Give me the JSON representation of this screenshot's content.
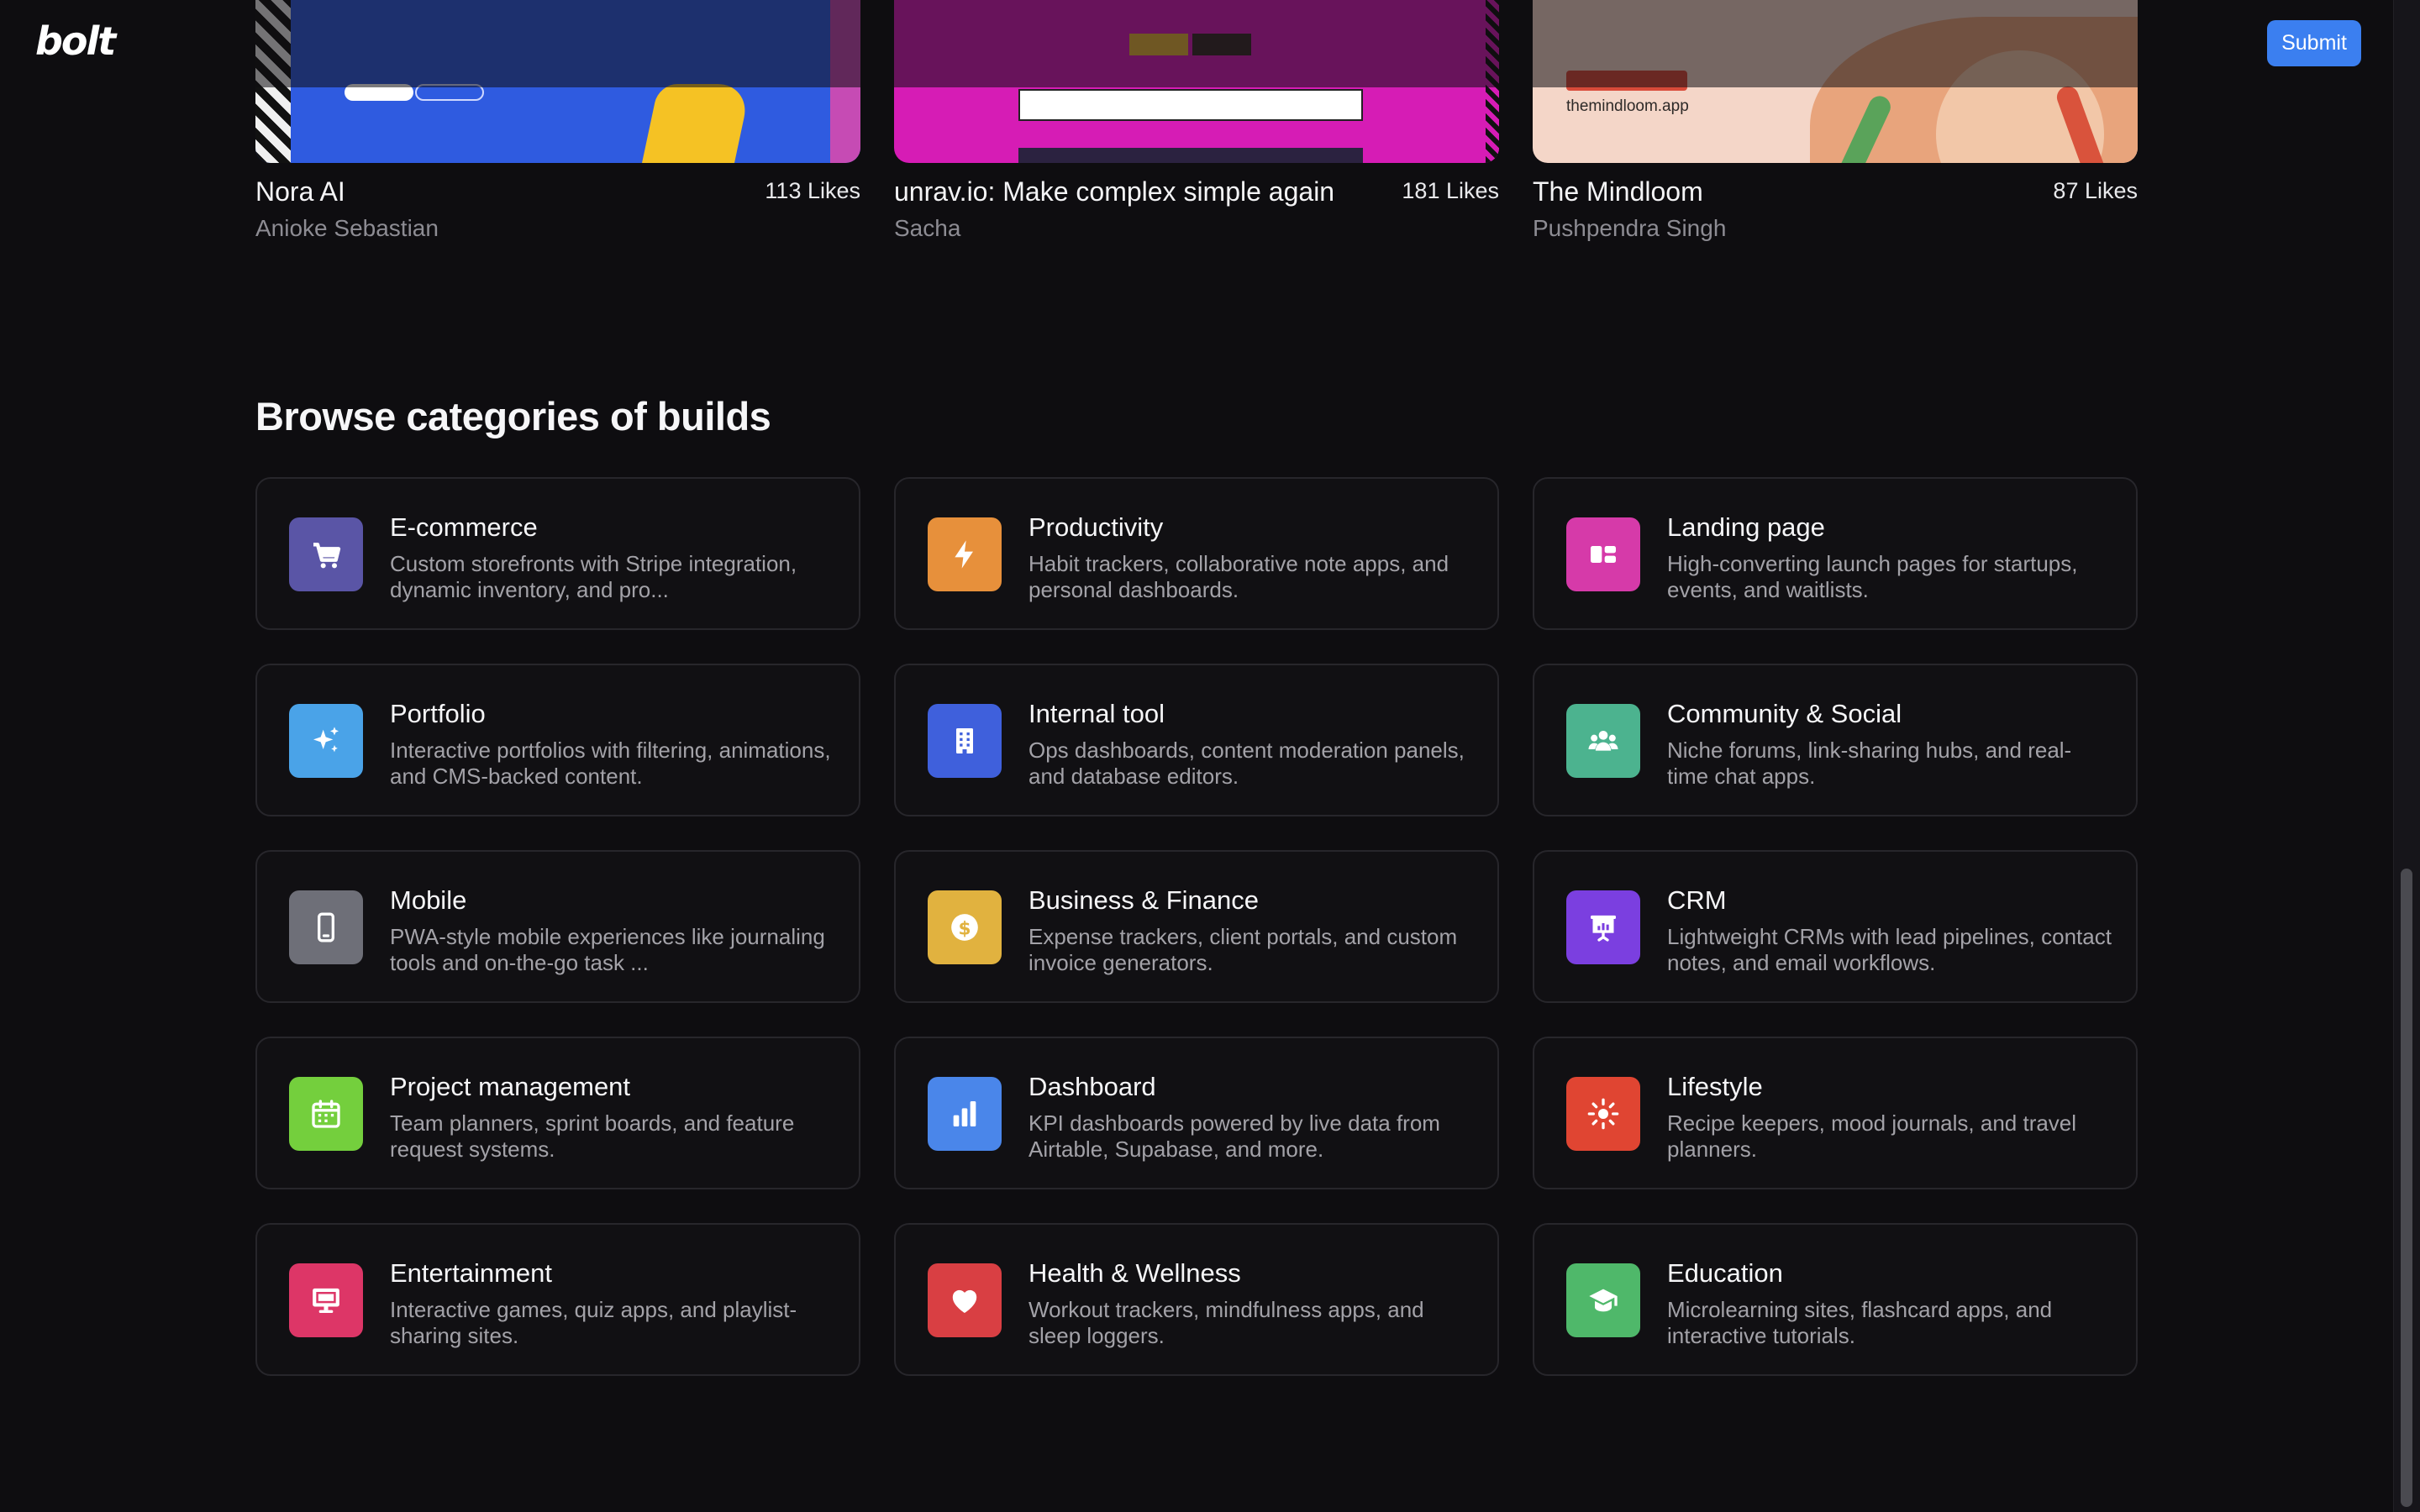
{
  "header": {
    "logo_text": "bolt",
    "submit_label": "Submit"
  },
  "showcase": [
    {
      "title": "Nora AI",
      "author": "Anioke Sebastian",
      "likes": "113 Likes"
    },
    {
      "title": "unrav.io: Make complex simple again",
      "author": "Sacha",
      "likes": "181 Likes"
    },
    {
      "title": "The Mindloom",
      "author": "Pushpendra Singh",
      "likes": "87 Likes",
      "thumb_domain": "themindloom.app"
    }
  ],
  "categories_section": {
    "title": "Browse categories of builds",
    "items": [
      {
        "name": "E-commerce",
        "description": "Custom storefronts with Stripe integration, dynamic inventory, and pro...",
        "icon": "cart-icon",
        "color": "#5a55a6"
      },
      {
        "name": "Productivity",
        "description": "Habit trackers, collaborative note apps, and personal dashboards.",
        "icon": "lightning-icon",
        "color": "#e7903b"
      },
      {
        "name": "Landing page",
        "description": "High-converting launch pages for startups, events, and waitlists.",
        "icon": "layout-icon",
        "color": "#d63aa9"
      },
      {
        "name": "Portfolio",
        "description": "Interactive portfolios with filtering, animations, and CMS-backed content.",
        "icon": "sparkles-icon",
        "color": "#4aa3e8"
      },
      {
        "name": "Internal tool",
        "description": "Ops dashboards, content moderation panels, and database editors.",
        "icon": "building-icon",
        "color": "#3f60dc"
      },
      {
        "name": "Community & Social",
        "description": "Niche forums, link-sharing hubs, and real-time chat apps.",
        "icon": "users-icon",
        "color": "#4cb38f"
      },
      {
        "name": "Mobile",
        "description": "PWA-style mobile experiences like journaling tools and on-the-go task ...",
        "icon": "phone-icon",
        "color": "#6e6f78"
      },
      {
        "name": "Business & Finance",
        "description": "Expense trackers, client portals, and custom invoice generators.",
        "icon": "dollar-icon",
        "color": "#e1b23f"
      },
      {
        "name": "CRM",
        "description": "Lightweight CRMs with lead pipelines, contact notes, and email workflows.",
        "icon": "presentation-icon",
        "color": "#7b3fe0"
      },
      {
        "name": "Project management",
        "description": "Team planners, sprint boards, and feature request systems.",
        "icon": "calendar-icon",
        "color": "#74cf3d"
      },
      {
        "name": "Dashboard",
        "description": "KPI dashboards powered by live data from Airtable, Supabase, and more.",
        "icon": "bar-chart-icon",
        "color": "#4a86ea"
      },
      {
        "name": "Lifestyle",
        "description": "Recipe keepers, mood journals, and travel planners.",
        "icon": "sun-icon",
        "color": "#e04532"
      },
      {
        "name": "Entertainment",
        "description": "Interactive games, quiz apps, and playlist-sharing sites.",
        "icon": "monitor-icon",
        "color": "#dd3667"
      },
      {
        "name": "Health & Wellness",
        "description": "Workout trackers, mindfulness apps, and sleep loggers.",
        "icon": "heart-icon",
        "color": "#d93f43"
      },
      {
        "name": "Education",
        "description": "Microlearning sites, flashcard apps, and interactive tutorials.",
        "icon": "graduation-cap-icon",
        "color": "#4fb86a"
      }
    ]
  }
}
